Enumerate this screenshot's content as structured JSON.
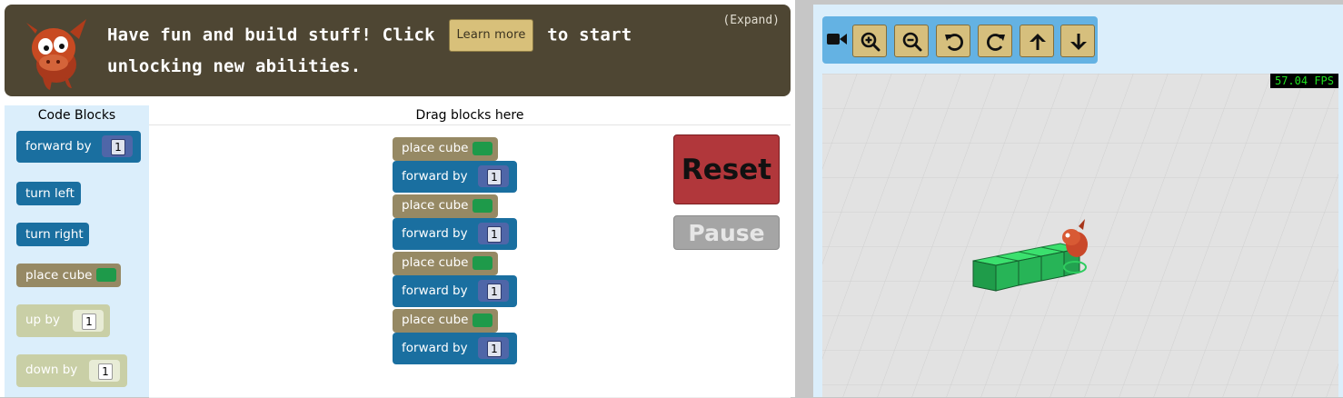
{
  "banner": {
    "text_before": "Have fun and build stuff! Click",
    "learn_more_label": "Learn more",
    "text_after": "to start unlocking new abilities.",
    "expand_label": "(Expand)"
  },
  "toolbox": {
    "title": "Code Blocks",
    "blocks": [
      {
        "label": "forward by",
        "value": "1"
      },
      {
        "label": "turn left"
      },
      {
        "label": "turn right"
      },
      {
        "label": "place cube"
      },
      {
        "label": "up by",
        "value": "1"
      },
      {
        "label": "down by",
        "value": "1"
      }
    ]
  },
  "workspace": {
    "title": "Drag blocks here",
    "program": [
      {
        "label": "place cube"
      },
      {
        "label": "forward by",
        "value": "1"
      },
      {
        "label": "place cube"
      },
      {
        "label": "forward by",
        "value": "1"
      },
      {
        "label": "place cube"
      },
      {
        "label": "forward by",
        "value": "1"
      },
      {
        "label": "place cube"
      },
      {
        "label": "forward by",
        "value": "1"
      }
    ]
  },
  "controls": {
    "reset_label": "Reset",
    "pause_label": "Pause"
  },
  "camera_toolbar": {
    "icons": [
      "video-camera-icon",
      "zoom-in-icon",
      "zoom-out-icon",
      "rotate-left-icon",
      "rotate-right-icon",
      "arrow-up-icon",
      "arrow-down-icon"
    ]
  },
  "viewport": {
    "fps": "57.04 FPS"
  },
  "colors": {
    "banner_bg": "#4e4633",
    "motion_block": "#1a6fa0",
    "place_block": "#968964",
    "reset": "#b1373b",
    "toolbar": "#64b2e3",
    "cube": "#2ecc5f"
  }
}
